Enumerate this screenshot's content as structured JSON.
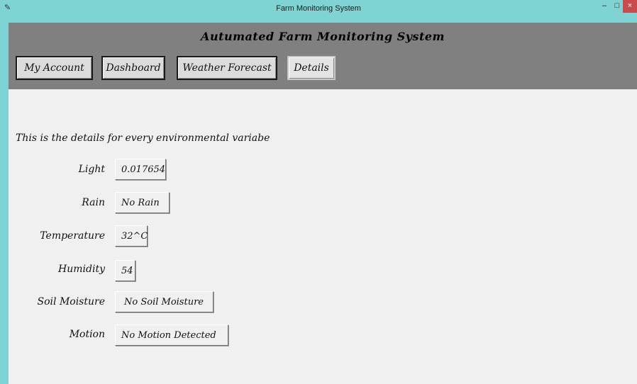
{
  "window": {
    "title": "Farm Monitoring System",
    "minimize": "–",
    "maximize": "□",
    "close": "×"
  },
  "header": {
    "app_title": "Autumated Farm Monitoring System"
  },
  "nav": {
    "my_account": "My Account",
    "dashboard": "Dashboard",
    "weather_forecast": "Weather Forecast",
    "details": "Details"
  },
  "details": {
    "intro": "This is the details for every environmental variabe",
    "rows": [
      {
        "label": "Light",
        "value": "0.017654"
      },
      {
        "label": "Rain",
        "value": "No Rain"
      },
      {
        "label": "Temperature",
        "value": "32^C"
      },
      {
        "label": "Humidity",
        "value": "54"
      },
      {
        "label": "Soil Moisture",
        "value": "No Soil Moisture"
      },
      {
        "label": "Motion",
        "value": "No Motion Detected"
      }
    ]
  }
}
